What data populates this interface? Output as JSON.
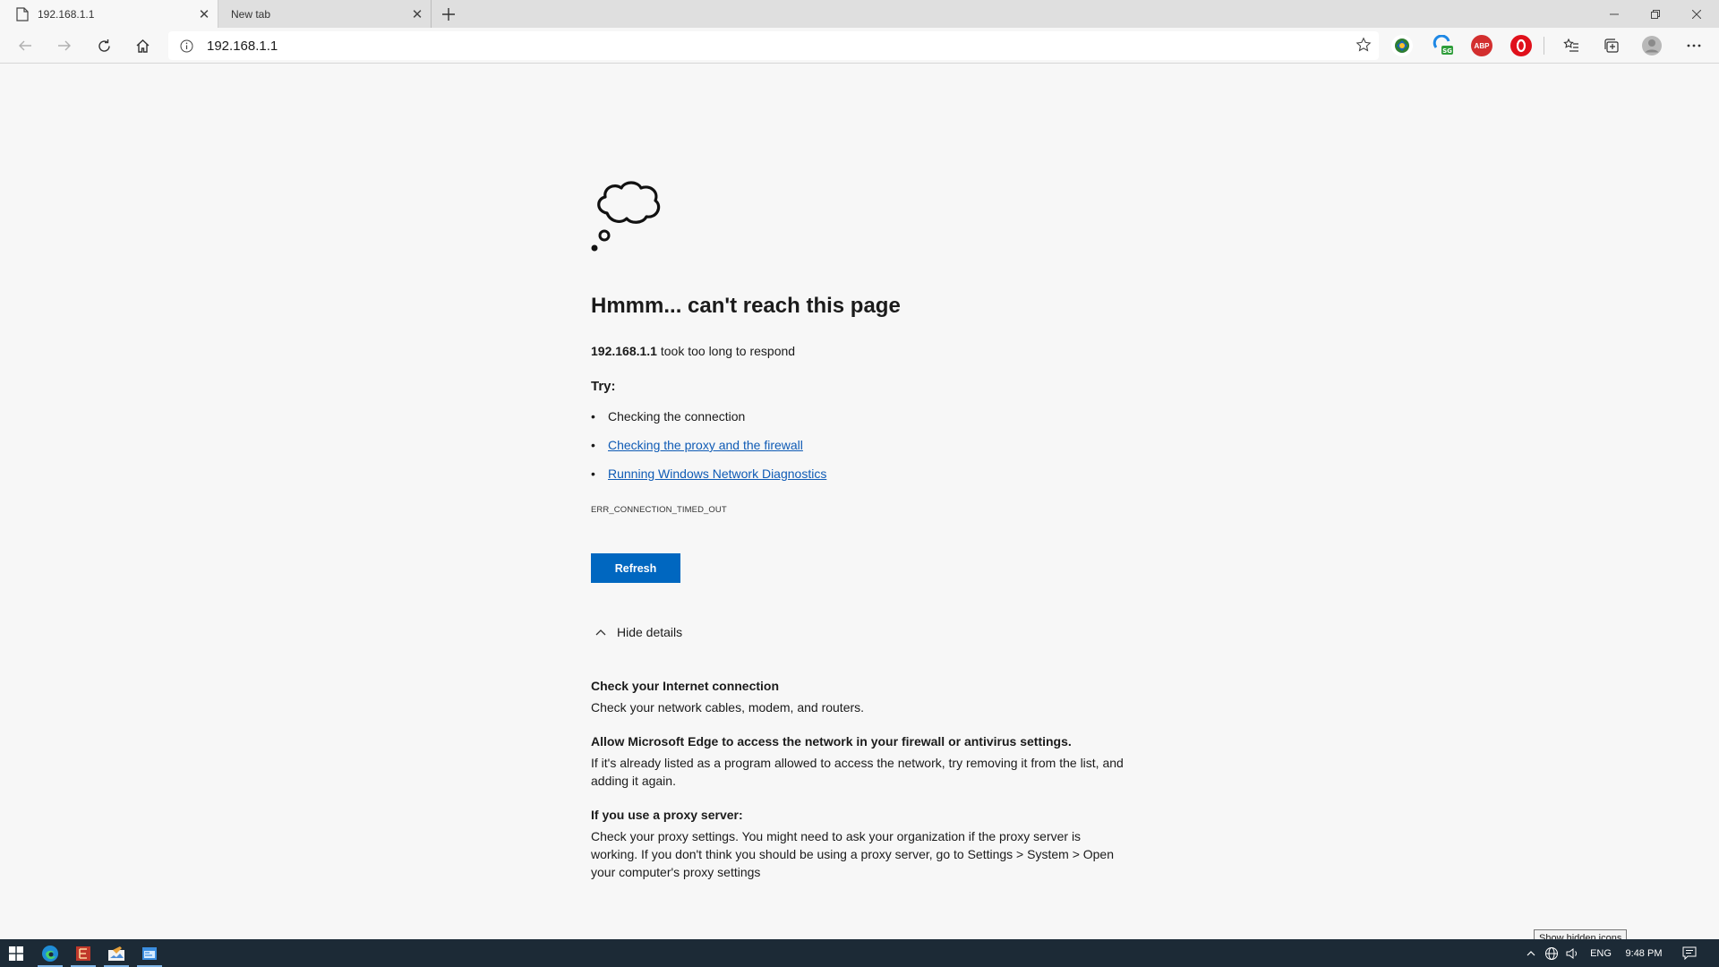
{
  "browser": {
    "tabs": [
      {
        "title": "192.168.1.1",
        "active": true
      },
      {
        "title": "New tab",
        "active": false
      }
    ],
    "address_bar": {
      "url": "192.168.1.1"
    },
    "extensions": [
      "shield-extension",
      "sg-extension",
      "adblock-plus-extension",
      "opera-extension"
    ]
  },
  "error_page": {
    "heading": "Hmmm... can't reach this page",
    "host": "192.168.1.1",
    "message": "took too long to respond",
    "try_label": "Try:",
    "suggestions": [
      {
        "text": "Checking the connection",
        "link": false
      },
      {
        "text": "Checking the proxy and the firewall",
        "link": true
      },
      {
        "text": "Running Windows Network Diagnostics",
        "link": true
      }
    ],
    "error_code": "ERR_CONNECTION_TIMED_OUT",
    "refresh_label": "Refresh",
    "hide_details_label": "Hide details",
    "details": [
      {
        "heading": "Check your Internet connection",
        "body": "Check your network cables, modem, and routers."
      },
      {
        "heading": "Allow Microsoft Edge to access the network in your firewall or antivirus settings.",
        "body": "If it's already listed as a program allowed to access the network, try removing it from the list, and adding it again."
      },
      {
        "heading": "If you use a proxy server:",
        "body": "Check your proxy settings. You might need to ask your organization if the proxy server is working. If you don't think you should be using a proxy server, go to Settings > System > Open your computer's proxy settings"
      }
    ]
  },
  "taskbar": {
    "tooltip": "Show hidden icons",
    "language": "ENG",
    "clock": "9:48 PM"
  },
  "colors": {
    "accent": "#0067c0",
    "link": "#0f5bb5",
    "page_bg": "#f7f7f7",
    "taskbar_bg": "#1c2a36"
  }
}
